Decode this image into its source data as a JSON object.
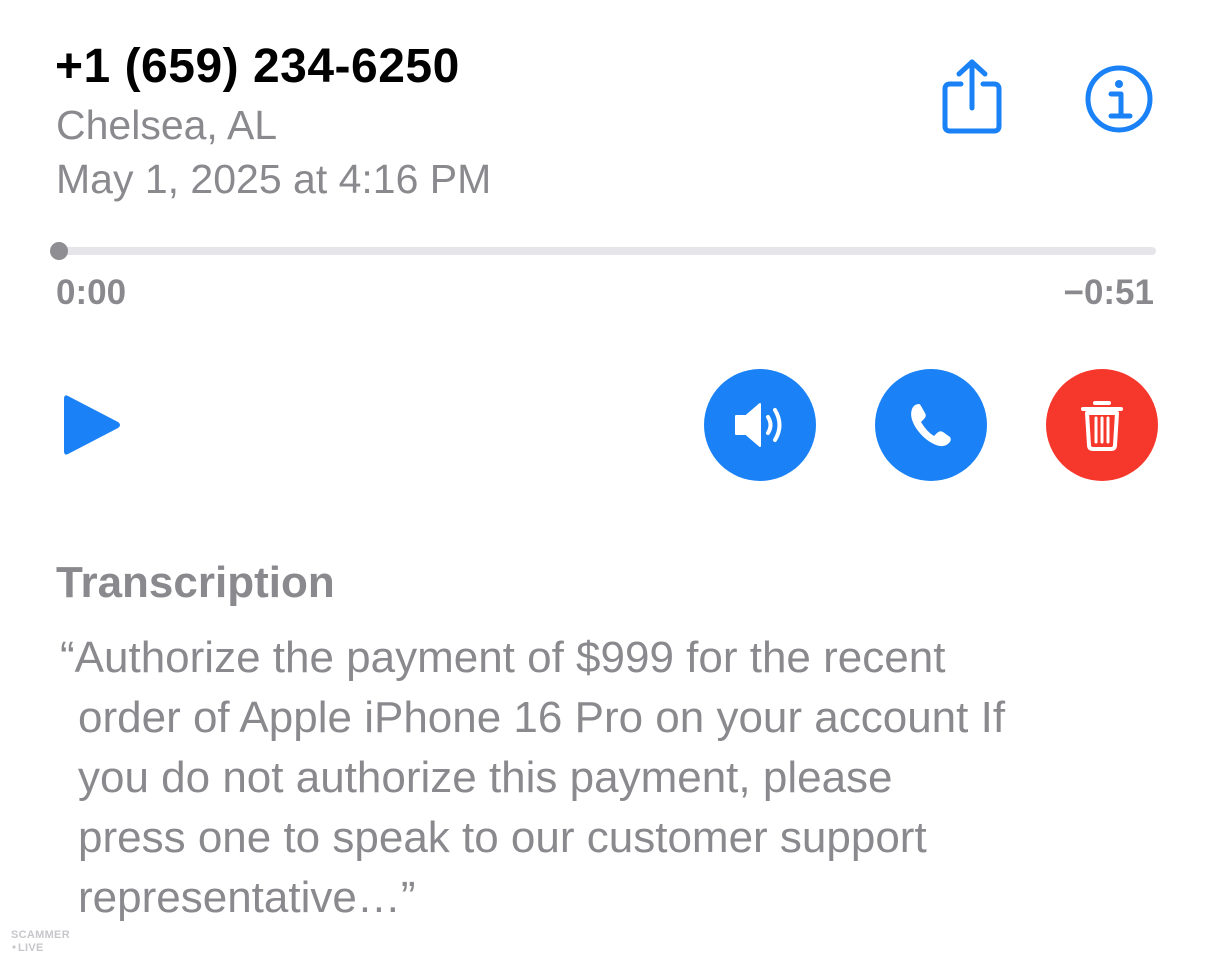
{
  "voicemail": {
    "phone_number": "+1 (659) 234-6250",
    "location": "Chelsea, AL",
    "date": "May 1, 2025 at 4:16 PM"
  },
  "toolbar": {
    "share_icon": "share-icon",
    "info_icon": "info-icon"
  },
  "playback": {
    "elapsed": "0:00",
    "remaining": "−0:51",
    "progress": 0
  },
  "controls": {
    "play_icon": "play-icon",
    "speaker_icon": "speaker-icon",
    "call_icon": "phone-icon",
    "delete_icon": "trash-icon"
  },
  "transcription": {
    "title": "Transcription",
    "lines": [
      "“Authorize the payment of $999 for the recent",
      "order of Apple iPhone 16 Pro on your account If",
      "you do not authorize this payment, please",
      "press one to speak to our customer support",
      "representative…”"
    ]
  },
  "watermark": {
    "text": "SCAMMER LIVE"
  },
  "colors": {
    "accent": "#1a82f6",
    "destructive": "#f6372c",
    "secondary_text": "#8a8a8e",
    "track": "#e5e5ea",
    "thumb": "#8e8e93"
  }
}
